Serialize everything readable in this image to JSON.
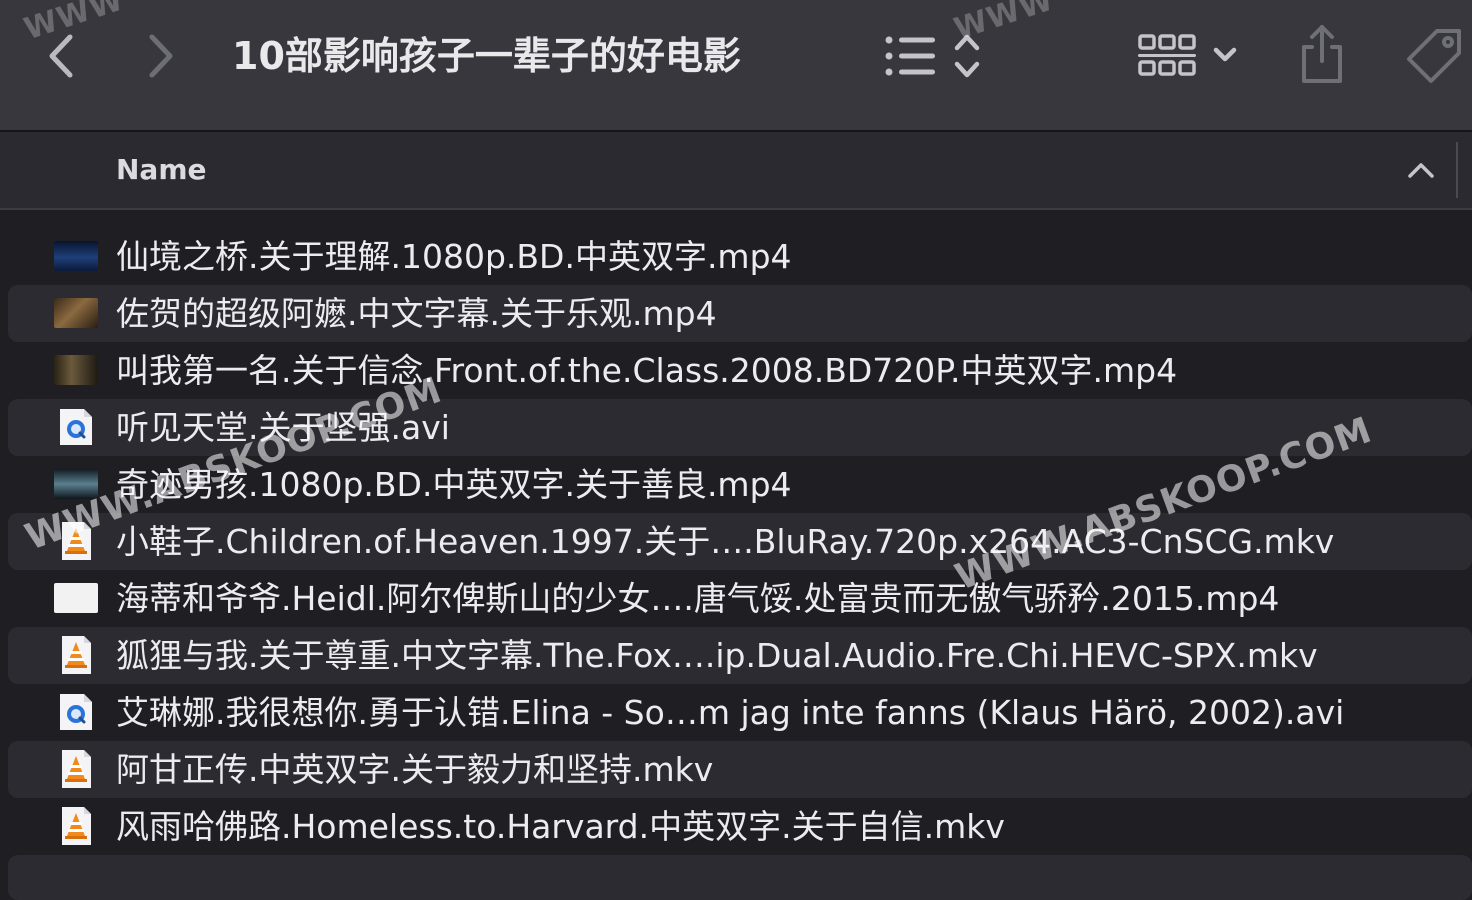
{
  "window": {
    "title": "10部影响孩子一辈子的好电影"
  },
  "toolbar": {
    "back_icon": "chevron-left-icon",
    "forward_icon": "chevron-right-icon",
    "list_view_icon": "list-view-icon",
    "sort_icon": "up-down-chevron-icon",
    "group_icon": "grid-group-icon",
    "group_menu_icon": "chevron-down-icon",
    "share_icon": "share-icon",
    "tag_icon": "tag-icon"
  },
  "columns": {
    "name_label": "Name",
    "sort_indicator_icon": "chevron-up-icon"
  },
  "files": [
    {
      "name": "仙境之桥.关于理解.1080p.BD.中英双字.mp4",
      "icon": "video-thumbnail"
    },
    {
      "name": "佐贺的超级阿嬷.中文字幕.关于乐观.mp4",
      "icon": "video-thumbnail"
    },
    {
      "name": "叫我第一名.关于信念.Front.of.the.Class.2008.BD720P.中英双字.mp4",
      "icon": "video-thumbnail"
    },
    {
      "name": "听见天堂.关于坚强.avi",
      "icon": "quicktime-file-icon"
    },
    {
      "name": "奇迹男孩.1080p.BD.中英双字.关于善良.mp4",
      "icon": "video-thumbnail"
    },
    {
      "name": "小鞋子.Children.of.Heaven.1997.关于….BluRay.720p.x264.AC3-CnSCG.mkv",
      "icon": "vlc-mkv-file-icon"
    },
    {
      "name": "海蒂和爷爷.Heidl.阿尔俾斯山的少女….唐气馁.处富贵而无傲气骄矜.2015.mp4",
      "icon": "video-thumbnail"
    },
    {
      "name": "狐狸与我.关于尊重.中文字幕.The.Fox….ip.Dual.Audio.Fre.Chi.HEVC-SPX.mkv",
      "icon": "vlc-mkv-file-icon"
    },
    {
      "name": "艾琳娜.我很想你.勇于认错.Elina - So…m jag inte fanns (Klaus Härö, 2002).avi",
      "icon": "quicktime-file-icon"
    },
    {
      "name": "阿甘正传.中英双字.关于毅力和坚持.mkv",
      "icon": "vlc-mkv-file-icon"
    },
    {
      "name": "风雨哈佛路.Homeless.to.Harvard.中英双字.关于自信.mkv",
      "icon": "vlc-mkv-file-icon"
    }
  ],
  "watermarks": {
    "text": "WWW.ABSKOOP.COM",
    "corner_text": "WWW"
  },
  "colors": {
    "toolbar_bg": "#38373d",
    "list_bg": "#1e1e23",
    "alt_row_bg": "#2b2b31",
    "text": "#ececf0"
  }
}
